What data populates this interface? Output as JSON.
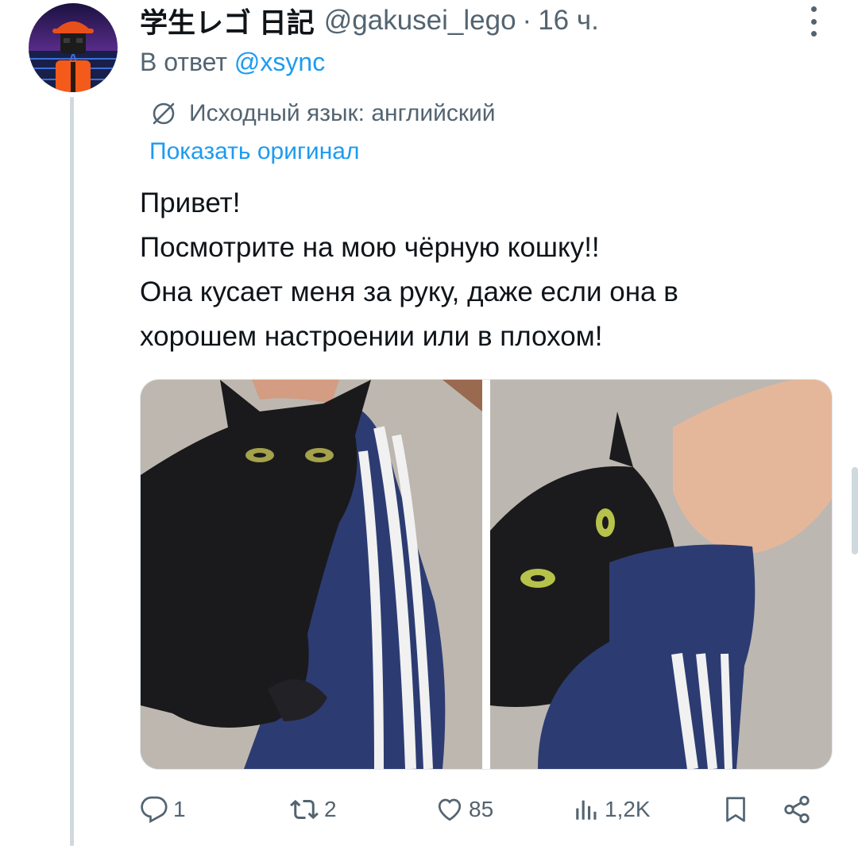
{
  "author": {
    "display_name": "学生レゴ 日記",
    "handle": "@gakusei_lego",
    "time_sep": "·",
    "time": "16 ч."
  },
  "reply": {
    "prefix": "В ответ",
    "mention": "@xsync"
  },
  "translation": {
    "label": "Исходный язык: английский",
    "show_original": "Показать оригинал"
  },
  "tweet_text": [
    "Привет!",
    "Посмотрите на мою чёрную кошку!!",
    "Она кусает меня за руку, даже если она в",
    "хорошем настроении или в плохом!"
  ],
  "actions": {
    "replies": "1",
    "reposts": "2",
    "likes": "85",
    "views": "1,2K"
  },
  "icons": {
    "more": "more-icon",
    "translate": "globe-slash-icon",
    "reply": "reply-icon",
    "repost": "repost-icon",
    "like": "heart-icon",
    "views": "views-icon",
    "bookmark": "bookmark-icon",
    "share": "share-icon"
  },
  "colors": {
    "text": "#0f1419",
    "secondary": "#536471",
    "accent": "#1d9bf0",
    "thread_line": "#cfd9de"
  }
}
